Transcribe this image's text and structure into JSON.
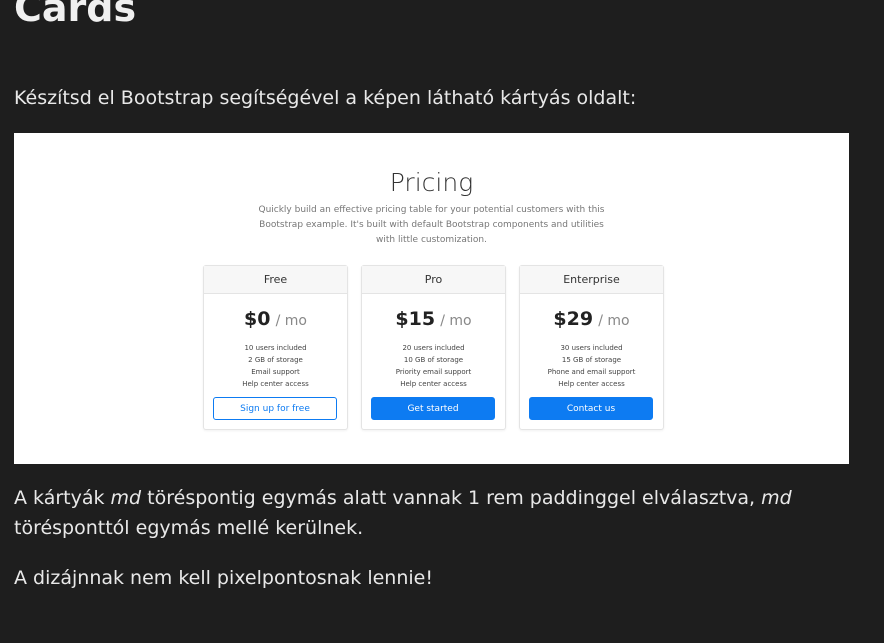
{
  "heading": "Cards",
  "intro": "Készítsd el Bootstrap segítségével a képen látható kártyás oldalt:",
  "example": {
    "title": "Pricing",
    "lead": "Quickly build an effective pricing table for your potential customers with this Bootstrap example. It's built with default Bootstrap components and utilities with little customization.",
    "colors": {
      "primary": "#0d7bf2",
      "card_header": "#f7f7f7"
    },
    "cards": [
      {
        "name": "Free",
        "price": "$0",
        "unit": "/ mo",
        "features": [
          "10 users included",
          "2 GB of storage",
          "Email support",
          "Help center access"
        ],
        "button": "Sign up for free"
      },
      {
        "name": "Pro",
        "price": "$15",
        "unit": "/ mo",
        "features": [
          "20 users included",
          "10 GB of storage",
          "Priority email support",
          "Help center access"
        ],
        "button": "Get started"
      },
      {
        "name": "Enterprise",
        "price": "$29",
        "unit": "/ mo",
        "features": [
          "30 users included",
          "15 GB of storage",
          "Phone and email support",
          "Help center access"
        ],
        "button": "Contact us"
      }
    ]
  },
  "para1": {
    "part1": "A kártyák ",
    "em1": "md",
    "part2": " töréspontig egymás alatt vannak 1 rem paddinggel elválasztva, ",
    "em2": "md",
    "part3": " törésponttól egymás mellé kerülnek."
  },
  "para2": "A dizájnnak nem kell pixelpontosnak lennie!"
}
